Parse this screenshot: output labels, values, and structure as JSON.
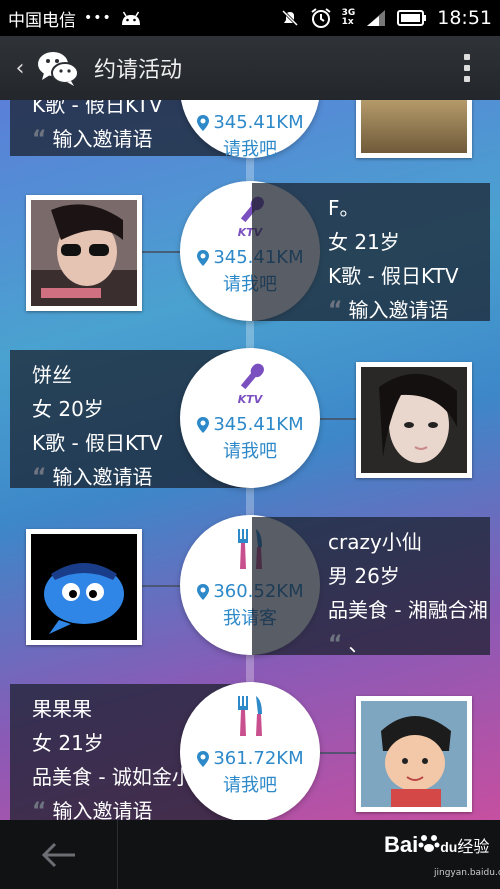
{
  "status_bar": {
    "carrier": "中国电信",
    "dots": "•••",
    "network_top": "3G",
    "network_bottom": "1x",
    "time": "18:51"
  },
  "title_bar": {
    "title": "约请活动"
  },
  "partial_row": {
    "activity": "K歌 - 假日KTV",
    "invite": "输入邀请语",
    "distance": "345.41KM",
    "action": "请我吧"
  },
  "rows": [
    {
      "name": "F。",
      "gender_age": "女 21岁",
      "activity": "K歌 - 假日KTV",
      "invite": "输入邀请语",
      "icon": "ktv-microphone-icon",
      "icon_label": "KTV",
      "distance": "345.41KM",
      "action": "请我吧"
    },
    {
      "name": "饼丝",
      "gender_age": "女 20岁",
      "activity": "K歌 - 假日KTV",
      "invite": "输入邀请语",
      "icon": "ktv-microphone-icon",
      "icon_label": "KTV",
      "distance": "345.41KM",
      "action": "请我吧"
    },
    {
      "name": "crazy小仙",
      "gender_age": "男 26岁",
      "activity": "品美食 - 湘融合湘",
      "invite": "、",
      "icon": "fork-knife-icon",
      "distance": "360.52KM",
      "action": "我请客"
    },
    {
      "name": "果果果",
      "gender_age": "女 21岁",
      "activity": "品美食 - 诚如金小",
      "invite": "输入邀请语",
      "icon": "fork-knife-icon",
      "distance": "361.72KM",
      "action": "请我吧"
    }
  ],
  "watermark": {
    "brand": "Bai",
    "brand2": "du",
    "brand3": "经验",
    "url": "jingyan.baidu.com"
  },
  "colors": {
    "accent": "#2e89c9",
    "icon_purple": "#7a4fbf"
  }
}
